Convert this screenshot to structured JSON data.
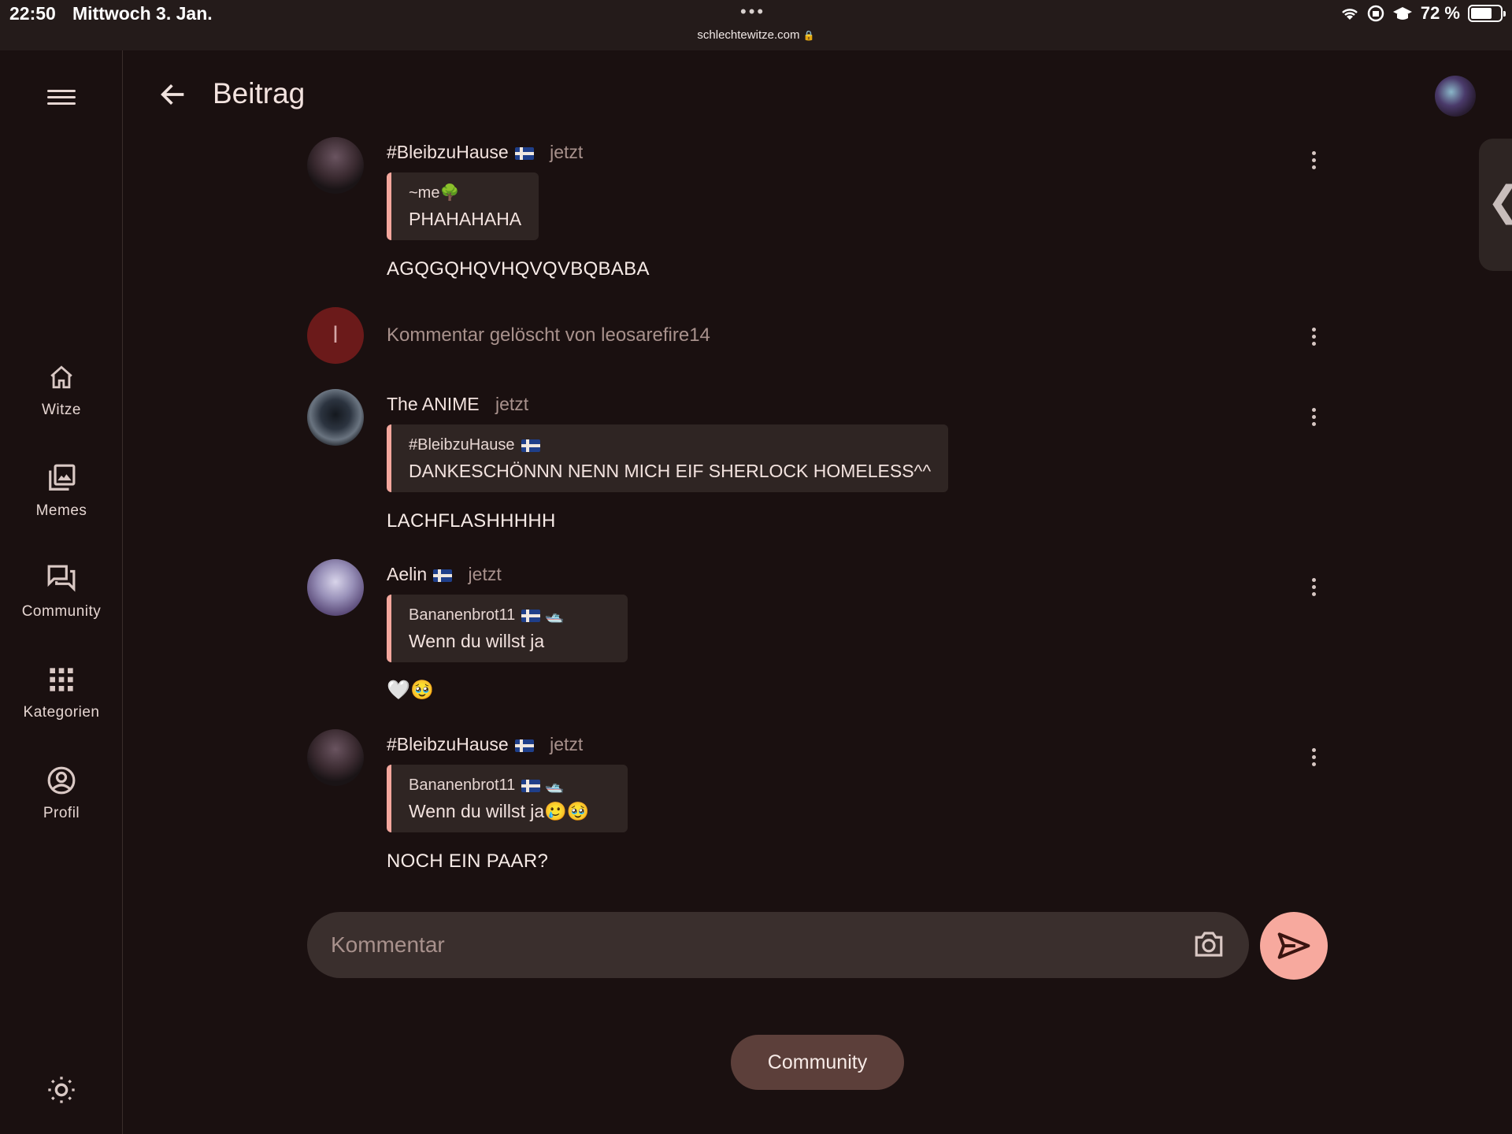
{
  "status_bar": {
    "time": "22:50",
    "date": "Mittwoch 3. Jan.",
    "url": "schlechtewitze.com",
    "battery": "72 %",
    "battery_level": 0.72
  },
  "rail": {
    "items": [
      {
        "label": "Witze",
        "icon": "home-icon"
      },
      {
        "label": "Memes",
        "icon": "image-gallery-icon"
      },
      {
        "label": "Community",
        "icon": "forum-icon"
      },
      {
        "label": "Kategorien",
        "icon": "grid-icon"
      },
      {
        "label": "Profil",
        "icon": "account-circle-icon"
      }
    ]
  },
  "header": {
    "title": "Beitrag"
  },
  "comments": [
    {
      "author": "#BleibzuHause",
      "time": "jetzt",
      "quote_author": "~me",
      "quote_text": "PHAHAHAHA",
      "body": "AGQGQHQVHQVQVBQBABA"
    },
    {
      "deleted_text": "Kommentar gelöscht von leosarefire14",
      "avatar_letter": "l"
    },
    {
      "author": "The ANIME",
      "time": "jetzt",
      "quote_author": "#BleibzuHause",
      "quote_text": "DANKESCHÖNNN NENN MICH EIF SHERLOCK HOMELESS^^",
      "body": "LACHFLASHHHHH"
    },
    {
      "author": "Aelin",
      "time": "jetzt",
      "quote_author": "Bananenbrot11",
      "quote_text": "Wenn du willst ja",
      "body": "🤍🥹"
    },
    {
      "author": "#BleibzuHause",
      "time": "jetzt",
      "quote_author": "Bananenbrot11",
      "quote_text": "Wenn du willst ja🥲🥹",
      "body": "NOCH EIN PAAR?"
    }
  ],
  "composer": {
    "placeholder": "Kommentar"
  },
  "footer": {
    "chip_label": "Community"
  },
  "colors": {
    "background": "#1a1010",
    "accent": "#f7a99e",
    "quote_bar": "#f4a79d",
    "chip": "#5c3f3a"
  }
}
